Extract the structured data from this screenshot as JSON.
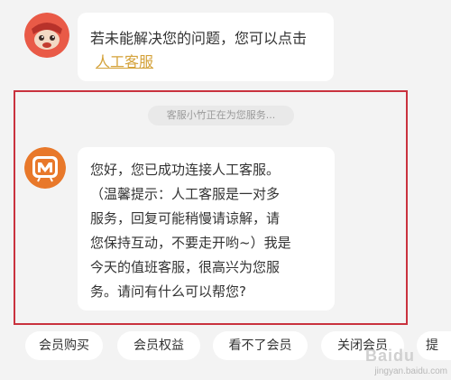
{
  "bot_message": {
    "text": "若未能解决您的问题，您可以点击",
    "link_label": "人工客服",
    "link_color": "#d4a23a"
  },
  "system_notice": "客服小竹正在为您服务...",
  "agent_message": {
    "lines": [
      "您好，您已成功连接人工客服。",
      "（温馨提示：人工客服是一对多",
      "服务，回复可能稍慢请谅解，请",
      "您保持互动，不要走开哟~）我是",
      "今天的值班客服，很高兴为您服",
      "务。请问有什么可以帮您?"
    ]
  },
  "quick_replies": [
    "会员购买",
    "会员权益",
    "看不了会员",
    "关闭会员",
    "提"
  ],
  "watermark": {
    "text": "jingyan.baidu.com",
    "logo_text": "Baidu"
  },
  "colors": {
    "background": "#f3f3f3",
    "bubble": "#ffffff",
    "highlight_border": "#c9323e",
    "brand_orange": "#e8782a"
  },
  "icons": {
    "bot_avatar": "mascot-icon",
    "agent_avatar": "mango-tv-logo-icon"
  }
}
